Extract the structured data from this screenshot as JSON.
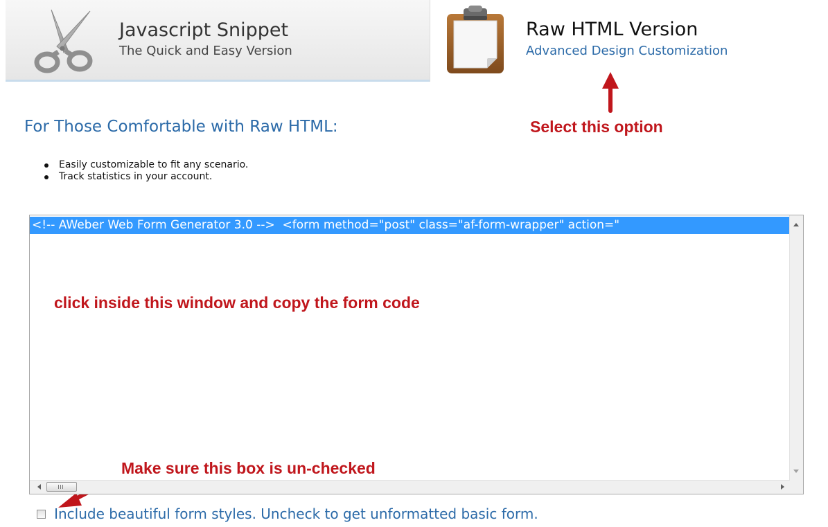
{
  "tabs": {
    "javascript": {
      "title": "Javascript Snippet",
      "subtitle": "The Quick and Easy Version",
      "icon": "scissors-icon"
    },
    "raw_html": {
      "title": "Raw HTML Version",
      "subtitle": "Advanced Design Customization",
      "icon": "clipboard-icon",
      "selected": true
    }
  },
  "section": {
    "heading": "For Those Comfortable with Raw HTML:",
    "bullets": [
      "Easily customizable to fit any scenario.",
      "Track statistics in your account."
    ]
  },
  "code_box": {
    "selected_text": "<!-- AWeber Web Form Generator 3.0 -->  <form method=\"post\" class=\"af-form-wrapper\" action=\""
  },
  "checkbox": {
    "label": "Include beautiful form styles. Uncheck to get unformatted basic form.",
    "checked": false
  },
  "annotations": {
    "select_option": "Select this option",
    "copy_code": "click inside this window and copy the form code",
    "uncheck_box": "Make sure this box is un-checked"
  },
  "colors": {
    "annotation_red": "#c0161c",
    "link_blue": "#2b6aa8",
    "selection_blue": "#3399ff"
  }
}
